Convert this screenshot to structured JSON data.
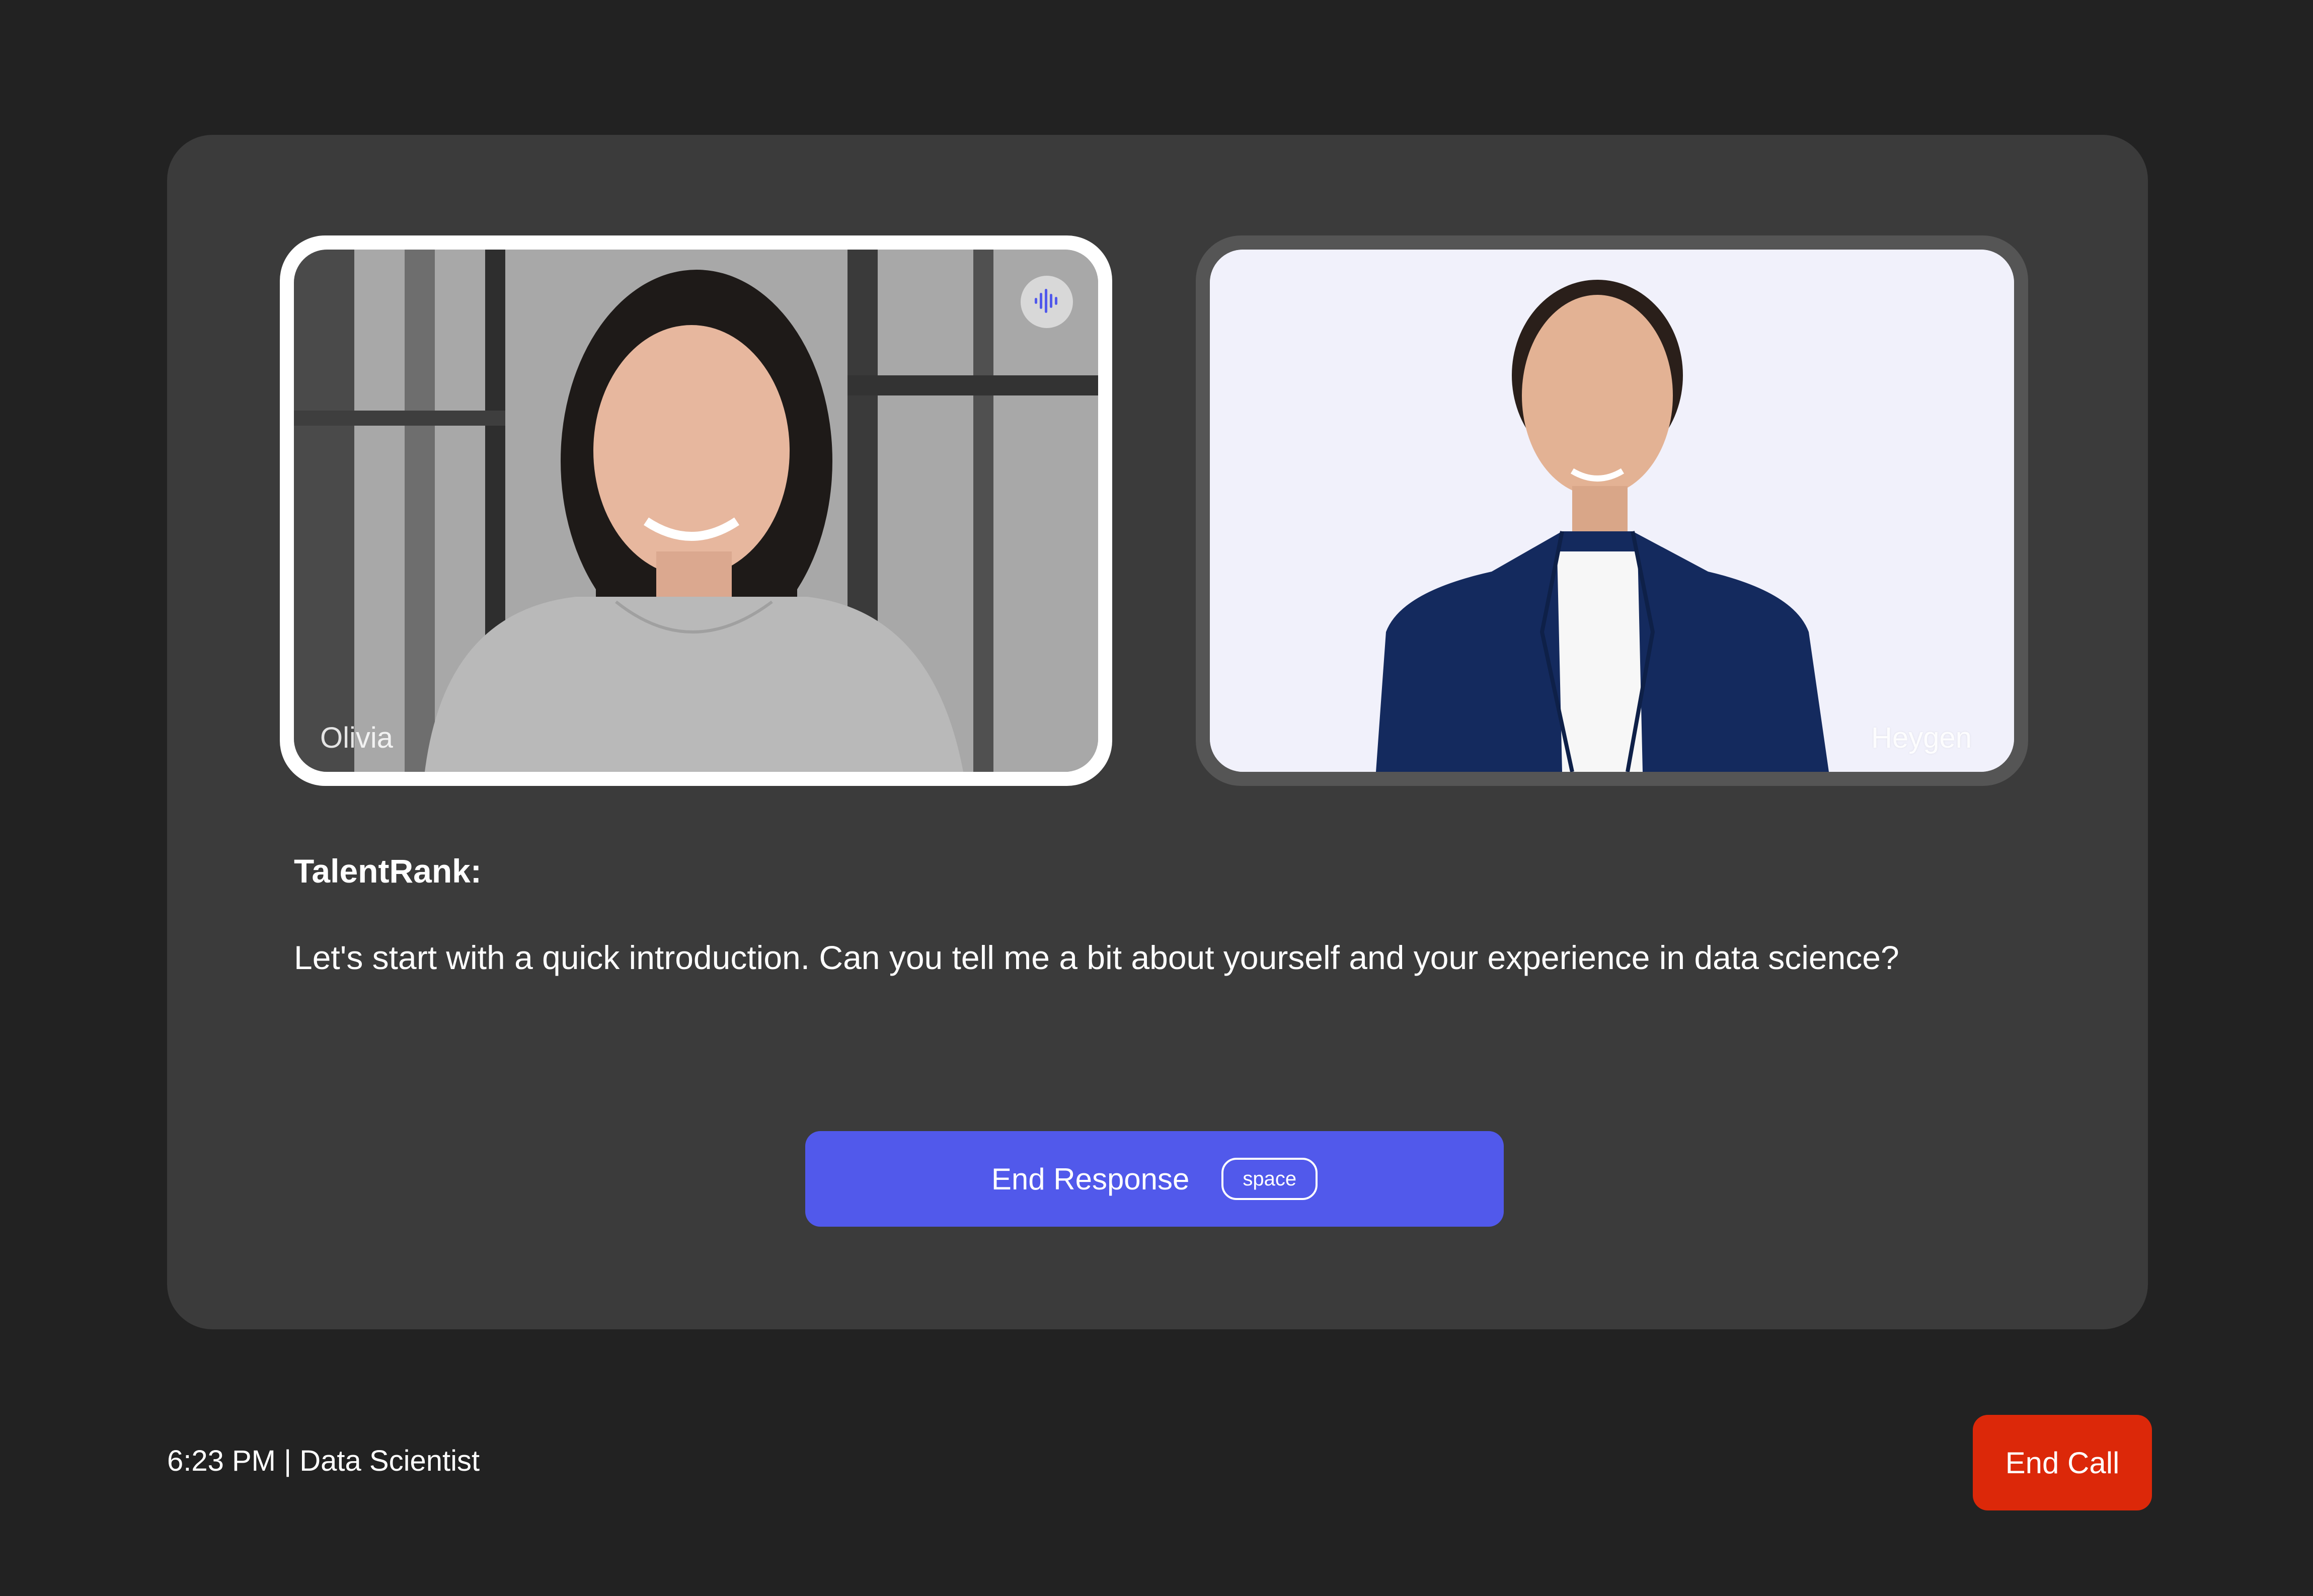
{
  "participants": {
    "user": {
      "name": "Olivia"
    },
    "ai": {
      "name": "Heygen"
    }
  },
  "transcript": {
    "speaker": "TalentRank:",
    "message": "Let's start with a quick introduction. Can you tell me a bit about yourself and your experience in data science?"
  },
  "controls": {
    "end_response_label": "End Response",
    "end_response_shortcut": "space",
    "end_call_label": "End Call"
  },
  "footer": {
    "status": "6:23 PM | Data Scientist"
  },
  "icons": {
    "speaking_indicator": "audio-wave-icon"
  },
  "colors": {
    "background": "#222222",
    "card": "#3b3b3b",
    "accent": "#5159eb",
    "danger": "#dc2809"
  }
}
